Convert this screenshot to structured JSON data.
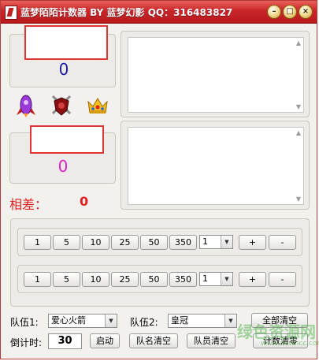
{
  "window": {
    "title": "蓝梦陌陌计数器 BY 蓝梦幻影 QQ：316483827",
    "minimize_glyph": "–",
    "maximize_glyph": "□",
    "close_glyph": "×"
  },
  "team1": {
    "score": "0",
    "score_color": "#1a1aa8"
  },
  "team2": {
    "score": "0",
    "score_color": "#e020c8"
  },
  "difference": {
    "label": "相差：",
    "value": "0",
    "color": "#e02020"
  },
  "icons": [
    "rocket-icon",
    "shield-swords-icon",
    "crown-icon"
  ],
  "row1": {
    "buttons": [
      "1",
      "5",
      "10",
      "25",
      "50",
      "350"
    ],
    "select_value": "1",
    "plus": "+",
    "minus": "-"
  },
  "row2": {
    "buttons": [
      "1",
      "5",
      "10",
      "25",
      "50",
      "350"
    ],
    "select_value": "1",
    "plus": "+",
    "minus": "-"
  },
  "bottom": {
    "team1_label": "队伍1:",
    "team1_value": "爱心火箭",
    "team2_label": "队伍2:",
    "team2_value": "皇冠",
    "clear_all": "全部清空",
    "countdown_label": "倒计时:",
    "countdown_value": "30",
    "start": "启动",
    "clear_names": "队名清空",
    "clear_members": "队员清空",
    "clear_counts": "计数清零"
  },
  "watermark": {
    "main": "绿色资源网",
    "sub": "www.downcc.com"
  }
}
